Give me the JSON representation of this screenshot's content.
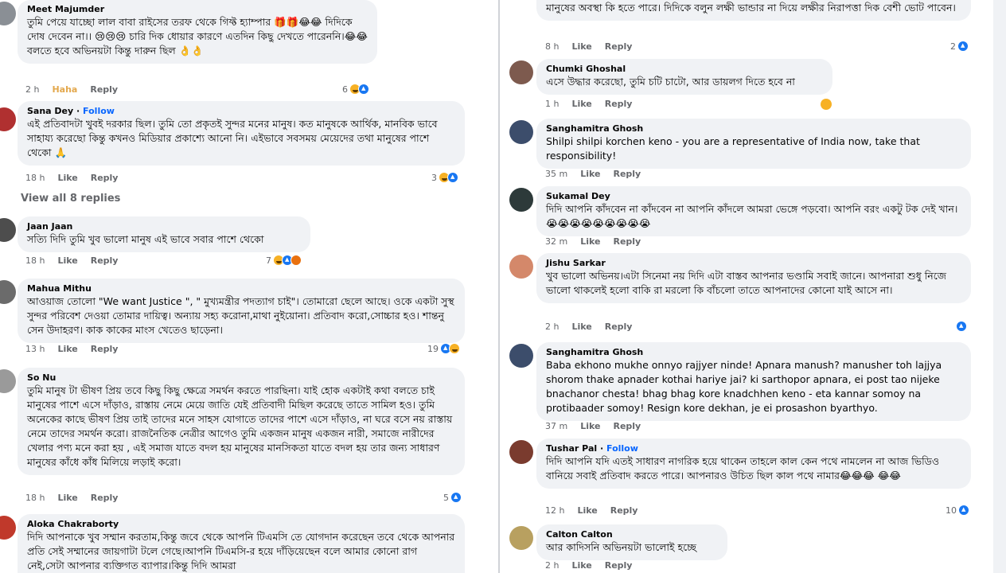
{
  "left": [
    {
      "name": "Meet Majumder",
      "follow": "",
      "text": "তুমি পেয়ে যাচ্ছো লাল বাবা রাইসের তরফ থেকে গিফ্ট হ্যাম্পার 🎁🎁😂😂 দিদিকে দোষ দেবেন না।। 😢😢😢 চারি দিক ধোয়ার কারণে এতদিন কিছু দেখতে পারেননি।😂😂 বলতে হবে অভিনয়টা কিন্তু দারুন ছিল 👌👌",
      "time": "2 h",
      "action1": "Haha",
      "action2": "Reply",
      "count": "6"
    },
    {
      "name": "Sana Dey",
      "follow": "Follow",
      "text": "এই প্রতিবাদটা খুবই দরকার ছিল। তুমি তো প্রকৃতই সুন্দর মনের মানুষ। কত মানুষকে আর্থিক, মানবিক ভাবে সাহায্য করেছো কিন্তু কখনও মিডিয়ার প্রকাশ্যে আনো নি। এইভাবে সবসময় মেয়েদের তথা মানুষের পাশে থেকো 🙏",
      "time": "18 h",
      "action1": "Like",
      "action2": "Reply",
      "count": "3"
    },
    {
      "name": "Jaan Jaan",
      "follow": "",
      "text": "সত্যি দিদি তুমি খুব ভালো মানুষ এই ভাবে সবার পাশে থেকো",
      "time": "18 h",
      "action1": "Like",
      "action2": "Reply",
      "count": "7"
    },
    {
      "name": "Mahua Mithu",
      "follow": "",
      "text": "আওয়াজ তোলো \"We want Justice \", \" মুখ্যমন্ত্রীর পদত্যাগ চাই\"। তোমারো ছেলে আছে। ওকে একটা সুস্থ সুন্দর পরিবেশ দেওয়া তোমার দায়িত্ব। অন্যায় সহ্য করোনা,মাথা নুইয়োনা। প্রতিবাদ করো,সোচ্চার হও। শান্তনু সেন উদাহরণ। কাক কাকের মাংস খেতেও ছাড়েনা।",
      "time": "13 h",
      "action1": "Like",
      "action2": "Reply",
      "count": "19"
    },
    {
      "name": "So Nu",
      "follow": "",
      "text": "তুমি মানুষ টা ভীষণ প্রিয় তবে কিছু কিছু ক্ষেত্রে সমর্থন করতে পারছিনা। যাই হোক একটাই কথা বলতে চাই মানুষের পাশে এসে দাঁড়াও, রাস্তায় নেমে মেয়ে জাতি যেই প্রতিবাদী মিছিল করেছে তাতে সামিল হও। তুমি অনেকের কাছে ভীষণ প্রিয় তাই তাদের মনে সাহস যোগাতে তাদের পাশে এসে দাঁড়াও, না ঘরে বসে নয় রাস্তায় নেমে তাদের সমর্থন করো। রাজনৈতিক নেত্রীর আগেও তুমি একজন মানুষ একজন নারী, সমাজে নারীদের খেলার পণ্য মনে করা হয় , এই সমাজ যাতে বদল হয় মানুষের মানসিকতা যাতে বদল হয় তার জন্য সাধারণ মানুষের কাঁধে কাঁধ মিলিয়ে লড়াই করো।",
      "time": "18 h",
      "action1": "Like",
      "action2": "Reply",
      "count": "5"
    },
    {
      "name": "Aloka Chakraborty",
      "follow": "",
      "text": "দিদি আপনাকে খুব সম্মান করতাম,কিন্তু জবে থেকে আপনি টিএমসি তে যোগদান করেছেন তবে থেকে আপনার প্রতি সেই সম্মানের জায়গাটা টলে গেছে।আপনি টিএমসি-র হয়ে দাঁড়িয়েছেন বলে আমার কোনো রাগ নেই,সেটা আপনার ব্যক্তিগত ব্যাপার।কিন্তু দিদি আমরা",
      "time": "",
      "action1": "",
      "action2": "",
      "count": ""
    }
  ],
  "view_all_replies": "View all 8 replies",
  "right": [
    {
      "name": "",
      "follow": "",
      "text": "মানুষের অবস্থা কি হতে পারে। দিদিকে বলুন লক্ষী ভান্ডার না দিয়ে লক্ষীর নিরাপত্তা দিক বেশী ভোট পাবেন।",
      "time": "8 h",
      "action1": "Like",
      "action2": "Reply",
      "count": "2"
    },
    {
      "name": "Chumki Ghoshal",
      "follow": "",
      "text": "এসে উদ্ধার করেছো, তুমি চটি চাটো, আর ডায়লগ দিতে হবে না",
      "time": "1 h",
      "action1": "Like",
      "action2": "Reply",
      "count": ""
    },
    {
      "name": "Sanghamitra Ghosh",
      "follow": "",
      "text": "Shilpi shilpi korchen keno - you are a representative of India now, take that responsibility!",
      "time": "35 m",
      "action1": "Like",
      "action2": "Reply",
      "count": ""
    },
    {
      "name": "Sukamal Dey",
      "follow": "",
      "text": "দিদি আপনি কাঁদবেন না কাঁদবেন না আপনি কাঁদলে আমরা ভেঙ্গে পড়বো। আপনি বরং একটু টক দেই খান।😭😭😭😭😭😭😭😭😭",
      "time": "32 m",
      "action1": "Like",
      "action2": "Reply",
      "count": ""
    },
    {
      "name": "Jishu Sarkar",
      "follow": "",
      "text": "খুব ভালো অভিনয়।এটা সিনেমা নয় দিদি এটা বাস্তব আপনার ভণ্ডামি সবাই জানে। আপনারা শুধু নিজে ভালো থাকলেই হলো বাকি রা মরলো কি বাঁচলো তাতে আপনাদের কোনো যাই আসে না।",
      "time": "2 h",
      "action1": "Like",
      "action2": "Reply",
      "count": ""
    },
    {
      "name": "Sanghamitra Ghosh",
      "follow": "",
      "text": "Baba ekhono mukhe onnyo rajjyer ninde! Apnara manush? manusher toh lajjya shorom thake apnader kothai hariye jai? ki sarthopor apnara, ei post tao nijeke bnachanor chesta! bhag bhag kore knadchhen keno - eta kannar somoy na protibaader somoy! Resign kore dekhan, je ei prosashon byarthyo.",
      "time": "37 m",
      "action1": "Like",
      "action2": "Reply",
      "count": ""
    },
    {
      "name": "Tushar Pal",
      "follow": "Follow",
      "text": "দিদি আপনি যদি এতই সাধারণ নাগরিক হয়ে থাকেন তাহলে কাল কেন পথে নামলেন না আজ ভিডিও বানিয়ে সবাই প্রতিবাদ করতে পারে। আপনারও উচিত ছিল কাল পথে নামার😂😂😂 😂😂",
      "time": "12 h",
      "action1": "Like",
      "action2": "Reply",
      "count": "10"
    },
    {
      "name": "Calton Calton",
      "follow": "",
      "text": "আর কাদিসনি অভিনয়টা ভালোই হচ্ছে",
      "time": "2 h",
      "action1": "Like",
      "action2": "Reply",
      "count": ""
    }
  ],
  "colors": {
    "bubble": "#f0f2f5",
    "follow_link": "#0866ff",
    "meta_text": "#65676b",
    "haha_action": "#e3a84d",
    "like_reaction": "#1877f2",
    "haha_reaction": "#f7b125"
  }
}
